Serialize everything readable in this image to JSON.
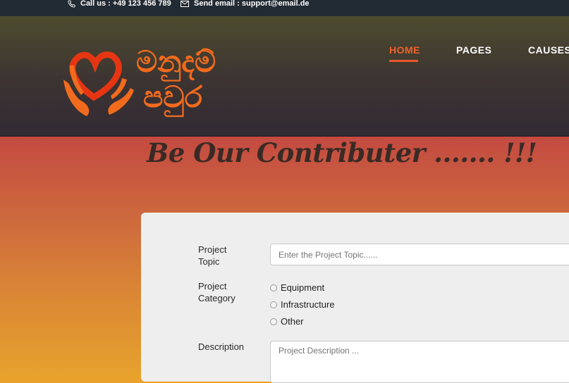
{
  "topbar": {
    "call": "Call us : +49 123 456 789",
    "email": "Send email : support@email.de"
  },
  "nav": {
    "items": [
      {
        "label": "HOME",
        "active": true
      },
      {
        "label": "PAGES",
        "active": false
      },
      {
        "label": "CAUSES",
        "active": false
      }
    ]
  },
  "logo": {
    "text_line1": "මනුදම්",
    "text_line2": "පවුර"
  },
  "page": {
    "heading": "Be Our Contributer ....... !!!"
  },
  "form": {
    "topic_label": "Project Topic",
    "topic_placeholder": "Enter the Project Topic......",
    "category_label": "Project Category",
    "categories": [
      "Equipment",
      "Infrastructure",
      "Other"
    ],
    "description_label": "Description",
    "description_placeholder": "Project Description ..."
  },
  "colors": {
    "accent": "#f0612a",
    "topbar": "#222a33",
    "text_dark": "#3a2a25"
  }
}
